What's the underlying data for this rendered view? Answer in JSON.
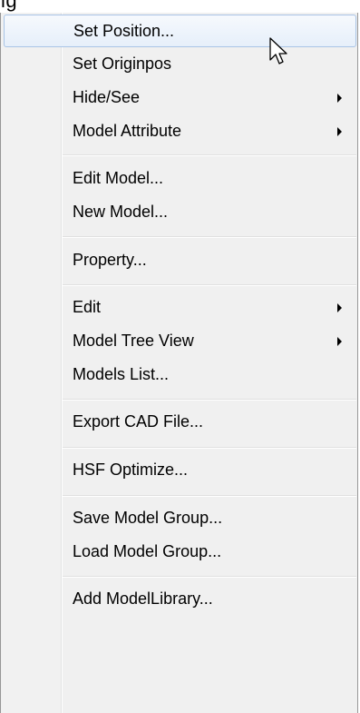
{
  "window": {
    "clipped_title": "ig"
  },
  "menu": {
    "groups": [
      {
        "items": [
          {
            "label": "Set Position...",
            "submenu": false,
            "hovered": true
          },
          {
            "label": "Set Originpos",
            "submenu": false
          },
          {
            "label": "Hide/See",
            "submenu": true
          },
          {
            "label": "Model Attribute",
            "submenu": true
          }
        ]
      },
      {
        "items": [
          {
            "label": "Edit Model...",
            "submenu": false
          },
          {
            "label": "New Model...",
            "submenu": false
          }
        ]
      },
      {
        "items": [
          {
            "label": "Property...",
            "submenu": false
          }
        ]
      },
      {
        "items": [
          {
            "label": "Edit",
            "submenu": true
          },
          {
            "label": "Model Tree View",
            "submenu": true
          },
          {
            "label": "Models List...",
            "submenu": false
          }
        ]
      },
      {
        "items": [
          {
            "label": "Export CAD File...",
            "submenu": false
          }
        ]
      },
      {
        "items": [
          {
            "label": "HSF Optimize...",
            "submenu": false
          }
        ]
      },
      {
        "items": [
          {
            "label": "Save Model Group...",
            "submenu": false
          },
          {
            "label": "Load Model Group...",
            "submenu": false
          }
        ]
      },
      {
        "items": [
          {
            "label": "Add ModelLibrary...",
            "submenu": false
          }
        ]
      }
    ]
  },
  "colors": {
    "hover_border": "#a9c4e6",
    "menu_background": "#f0f0f0",
    "gutter_background": "#f1f1f1"
  },
  "icons": [
    "submenu-arrow-icon",
    "mouse-cursor-icon"
  ]
}
